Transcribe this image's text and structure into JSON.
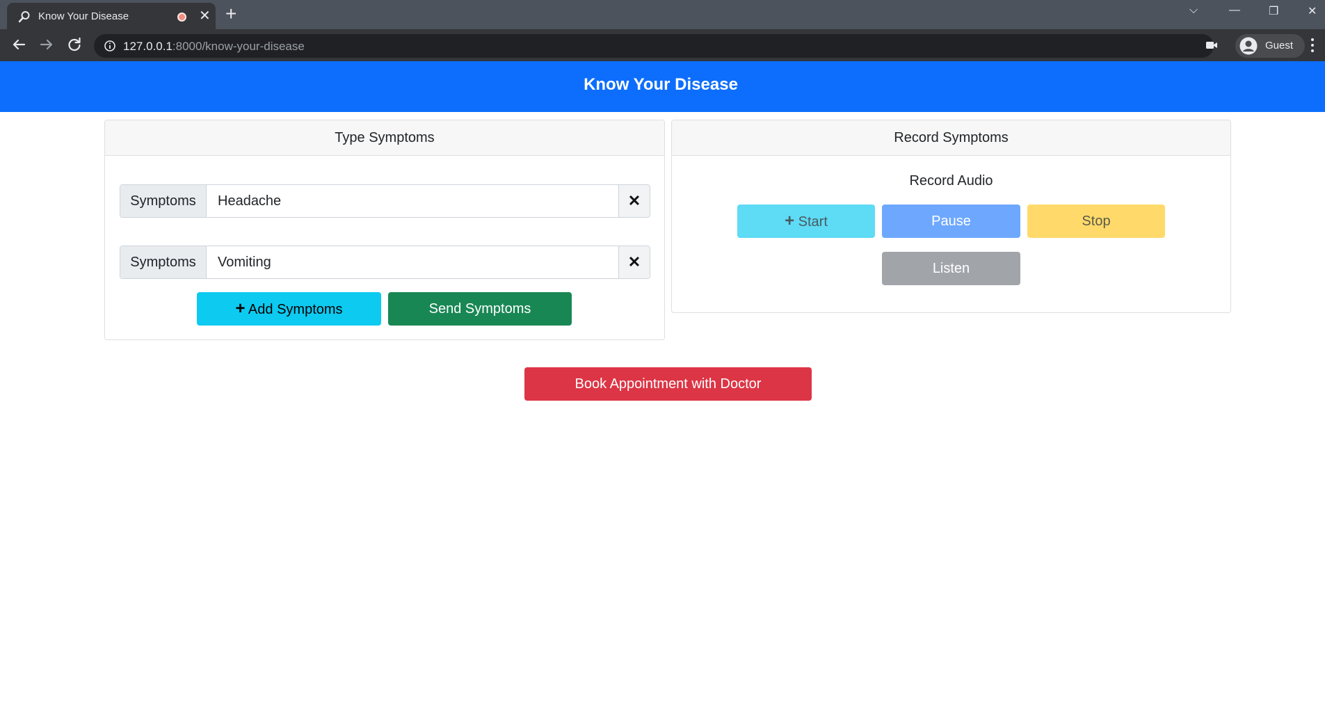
{
  "browser": {
    "tab_title": "Know Your Disease",
    "url_host": "127.0.0.1",
    "url_rest": ":8000/know-your-disease",
    "profile_name": "Guest"
  },
  "navbar": {
    "title": "Know Your Disease"
  },
  "type_card": {
    "header": "Type Symptoms",
    "rows": [
      {
        "label": "Symptoms",
        "value": "Headache"
      },
      {
        "label": "Symptoms",
        "value": "Vomiting"
      }
    ],
    "add_button": "Add Symptoms",
    "send_button": "Send Symptoms"
  },
  "record_card": {
    "header": "Record Symptoms",
    "subtitle": "Record Audio",
    "start_button": "Start",
    "pause_button": "Pause",
    "stop_button": "Stop",
    "listen_button": "Listen"
  },
  "book_button": "Book Appointment with Doctor",
  "colors": {
    "navbar": "#0d6efd",
    "info": "#0dcaf0",
    "success": "#198754",
    "danger": "#dc3545",
    "warning": "#ffda6a",
    "secondary": "#a1a5aa"
  }
}
